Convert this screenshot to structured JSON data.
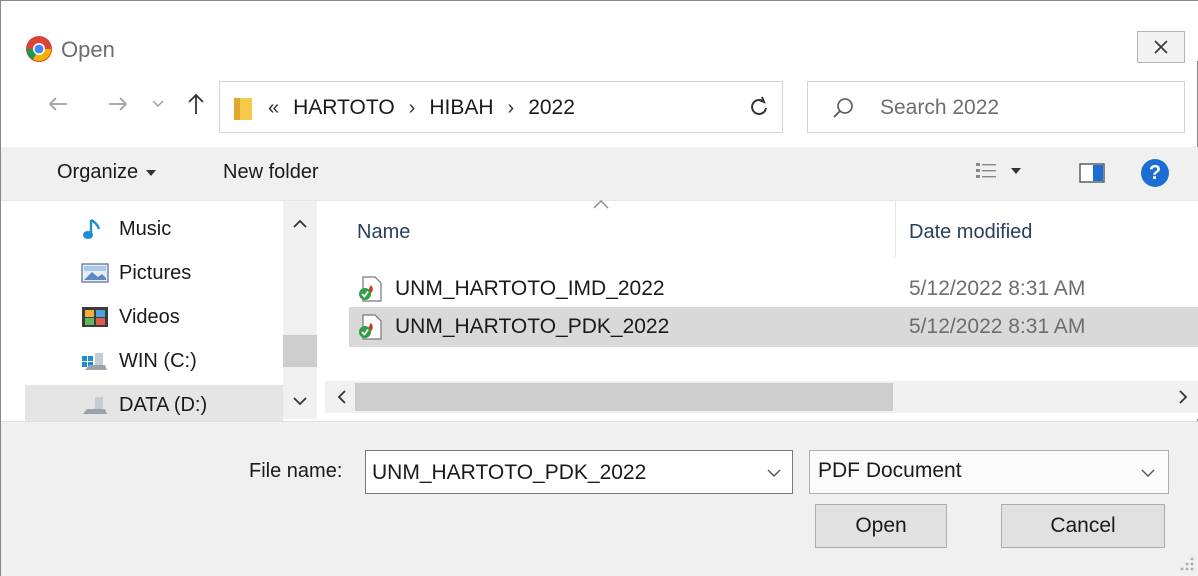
{
  "window": {
    "title": "Open",
    "close_icon": "close-icon"
  },
  "navigation": {
    "back_icon": "arrow-left-icon",
    "forward_icon": "arrow-right-icon",
    "recent_icon": "chevron-down-icon",
    "up_icon": "arrow-up-icon",
    "overflow": "«",
    "breadcrumbs": [
      "HARTOTO",
      "HIBAH",
      "2022"
    ],
    "refresh_icon": "refresh-icon",
    "search_placeholder": "Search 2022"
  },
  "toolbar": {
    "organize_label": "Organize",
    "new_folder_label": "New folder",
    "view_icon": "view-list-icon",
    "preview_icon": "preview-pane-icon",
    "help_label": "?"
  },
  "navpane": {
    "items": [
      {
        "label": "Music",
        "icon": "music-icon"
      },
      {
        "label": "Pictures",
        "icon": "pictures-icon"
      },
      {
        "label": "Videos",
        "icon": "videos-icon"
      },
      {
        "label": "WIN (C:)",
        "icon": "drive-icon"
      },
      {
        "label": "DATA (D:)",
        "icon": "drive-icon",
        "selected": true
      }
    ]
  },
  "filelist": {
    "columns": {
      "name": "Name",
      "date": "Date modified"
    },
    "rows": [
      {
        "name": "UNM_HARTOTO_IMD_2022",
        "date": "5/12/2022 8:31 AM",
        "selected": false
      },
      {
        "name": "UNM_HARTOTO_PDK_2022",
        "date": "5/12/2022 8:31 AM",
        "selected": true
      }
    ]
  },
  "footer": {
    "file_name_label": "File name:",
    "file_name_value": "UNM_HARTOTO_PDK_2022",
    "file_type_value": "PDF Document",
    "open_label": "Open",
    "cancel_label": "Cancel"
  },
  "colors": {
    "accent": "#1c6ed4",
    "selection": "#d9d9d9",
    "folder": "#f7c948",
    "pdf_red": "#d93025",
    "check_green": "#2e9e44"
  }
}
